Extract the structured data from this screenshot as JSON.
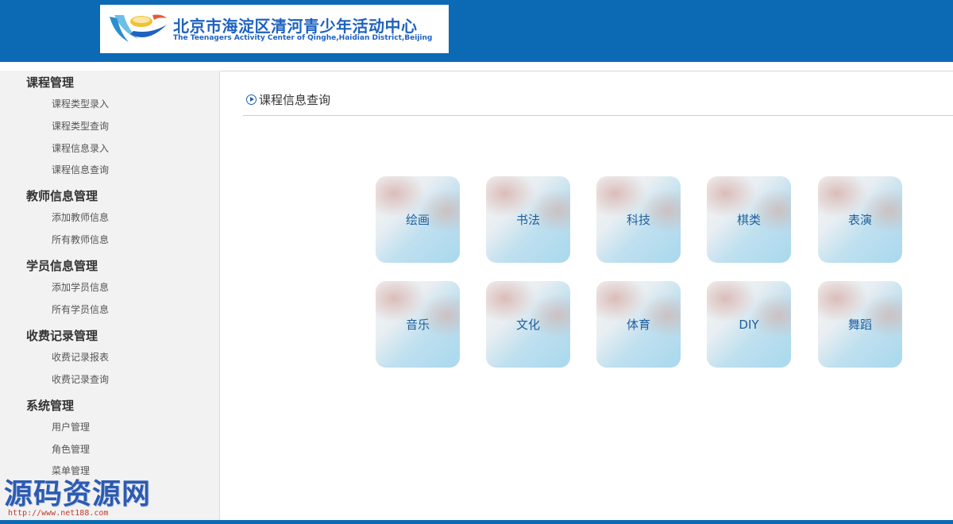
{
  "header": {
    "logo_cn": "北京市海淀区清河青少年活动中心",
    "logo_en": "The Teenagers Activity Center of Qinghe,Haidian District,Beijing",
    "background_color": "#0c6ab5"
  },
  "sidebar": {
    "groups": [
      {
        "title": "课程管理",
        "items": [
          "课程类型录入",
          "课程类型查询",
          "课程信息录入",
          "课程信息查询"
        ]
      },
      {
        "title": "教师信息管理",
        "items": [
          "添加教师信息",
          "所有教师信息"
        ]
      },
      {
        "title": "学员信息管理",
        "items": [
          "添加学员信息",
          "所有学员信息"
        ]
      },
      {
        "title": "收费记录管理",
        "items": [
          "收费记录报表",
          "收费记录查询"
        ]
      },
      {
        "title": "系统管理",
        "items": [
          "用户管理",
          "角色管理",
          "菜单管理"
        ]
      }
    ]
  },
  "main": {
    "title": "课程信息查询",
    "title_icon": "play-circle-icon",
    "categories": [
      "绘画",
      "书法",
      "科技",
      "棋类",
      "表演",
      "音乐",
      "文化",
      "体育",
      "DIY",
      "舞蹈"
    ]
  },
  "watermark": {
    "text": "源码资源网",
    "url": "http://www.net188.com"
  }
}
